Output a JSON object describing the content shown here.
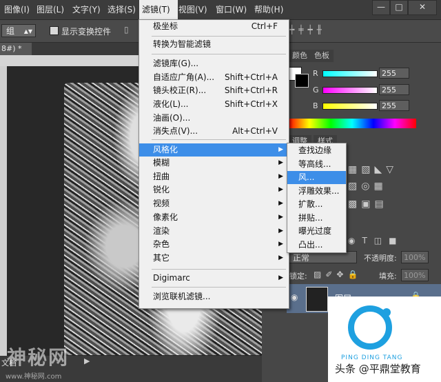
{
  "menubar": {
    "items": [
      "图像(I)",
      "图层(L)",
      "文字(Y)",
      "选择(S)",
      "滤镜(T)",
      "视图(V)",
      "窗口(W)",
      "帮助(H)"
    ],
    "active": "滤镜(T)"
  },
  "window_buttons": [
    "—",
    "□",
    "✕"
  ],
  "options": {
    "group_select": "组",
    "show_transform_label": "显示变换控件"
  },
  "document": {
    "tab_label": "8#) *"
  },
  "status": {
    "label": "文档"
  },
  "panels": {
    "tabs": [
      "颜色",
      "色板"
    ],
    "color": {
      "channels": [
        {
          "label": "R",
          "value": "255",
          "color": "#00e5ff"
        },
        {
          "label": "G",
          "value": "255",
          "color": "#ff00ff"
        },
        {
          "label": "B",
          "value": "255",
          "color": "#ffff00"
        }
      ]
    },
    "adjust_tabs": [
      "调整",
      "样式"
    ],
    "layers": {
      "blend_mode": "正常",
      "opacity_label": "不透明度:",
      "opacity_value": "100%",
      "lock_label": "锁定:",
      "fill_label": "填充:",
      "fill_value": "100%",
      "layer_name": "图层"
    }
  },
  "filter_menu": {
    "items": [
      {
        "label": "极坐标",
        "shortcut": "Ctrl+F"
      },
      {
        "label": "转换为智能滤镜",
        "shortcut": ""
      },
      {
        "label": "滤镜库(G)...",
        "shortcut": ""
      },
      {
        "label": "自适应广角(A)...",
        "shortcut": "Shift+Ctrl+A"
      },
      {
        "label": "镜头校正(R)...",
        "shortcut": "Shift+Ctrl+R"
      },
      {
        "label": "液化(L)...",
        "shortcut": "Shift+Ctrl+X"
      },
      {
        "label": "油画(O)...",
        "shortcut": ""
      },
      {
        "label": "消失点(V)...",
        "shortcut": "Alt+Ctrl+V"
      },
      {
        "label": "风格化",
        "shortcut": "",
        "submenu": true,
        "highlighted": true
      },
      {
        "label": "模糊",
        "shortcut": "",
        "submenu": true
      },
      {
        "label": "扭曲",
        "shortcut": "",
        "submenu": true
      },
      {
        "label": "锐化",
        "shortcut": "",
        "submenu": true
      },
      {
        "label": "视频",
        "shortcut": "",
        "submenu": true
      },
      {
        "label": "像素化",
        "shortcut": "",
        "submenu": true
      },
      {
        "label": "渲染",
        "shortcut": "",
        "submenu": true
      },
      {
        "label": "杂色",
        "shortcut": "",
        "submenu": true
      },
      {
        "label": "其它",
        "shortcut": "",
        "submenu": true
      },
      {
        "label": "Digimarc",
        "shortcut": "",
        "submenu": true
      },
      {
        "label": "浏览联机滤镜...",
        "shortcut": ""
      }
    ]
  },
  "stylize_submenu": {
    "items": [
      "查找边缘",
      "等高线...",
      "风...",
      "浮雕效果...",
      "扩散...",
      "拼贴...",
      "曝光过度",
      "凸出..."
    ],
    "highlighted": "风..."
  },
  "watermarks": {
    "left": "神秘网",
    "left_sub": "www.神秘网.com",
    "pinyin": "PING DING TANG",
    "brand": "头条 @平鼎堂教育"
  }
}
